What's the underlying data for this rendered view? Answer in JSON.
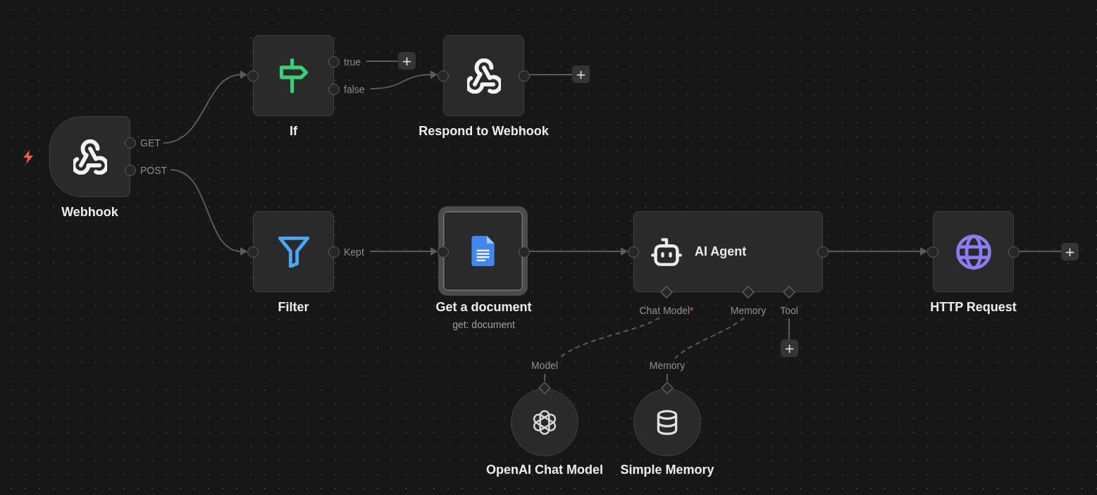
{
  "canvas": {
    "nodes": [
      {
        "kind": "trigger",
        "label": "Webhook",
        "selected": false,
        "outputs": [
          {
            "label": "GET",
            "connected": true
          },
          {
            "label": "POST",
            "connected": true
          }
        ]
      },
      {
        "kind": "action",
        "label": "If",
        "selected": false,
        "outputs": [
          {
            "label": "true",
            "connected": false,
            "add_button": "+"
          },
          {
            "label": "false",
            "connected": true
          }
        ]
      },
      {
        "kind": "action",
        "label": "Respond to Webhook",
        "selected": false,
        "outputs": [
          {
            "connected": false,
            "add_button": "+"
          }
        ]
      },
      {
        "kind": "action",
        "label": "Filter",
        "selected": false,
        "outputs": [
          {
            "label": "Kept",
            "connected": true
          }
        ]
      },
      {
        "kind": "action",
        "label": "Get a document",
        "subtitle": "get: document",
        "selected": true,
        "outputs": [
          {
            "connected": true
          }
        ]
      },
      {
        "kind": "agent",
        "label": "AI Agent",
        "selected": false,
        "outputs": [
          {
            "connected": true
          }
        ],
        "sub_inputs": [
          {
            "label": "Chat Model",
            "required_mark": "*",
            "connected": true
          },
          {
            "label": "Memory",
            "connected": true
          },
          {
            "label": "Tool",
            "connected": false,
            "add_button": "+"
          }
        ]
      },
      {
        "kind": "action",
        "label": "HTTP Request",
        "selected": false,
        "outputs": [
          {
            "connected": false,
            "add_button": "+"
          }
        ]
      },
      {
        "kind": "sub",
        "label": "OpenAI Chat Model",
        "selected": false,
        "port_label": "Model"
      },
      {
        "kind": "sub",
        "label": "Simple Memory",
        "selected": false,
        "port_label": "Memory"
      }
    ]
  }
}
